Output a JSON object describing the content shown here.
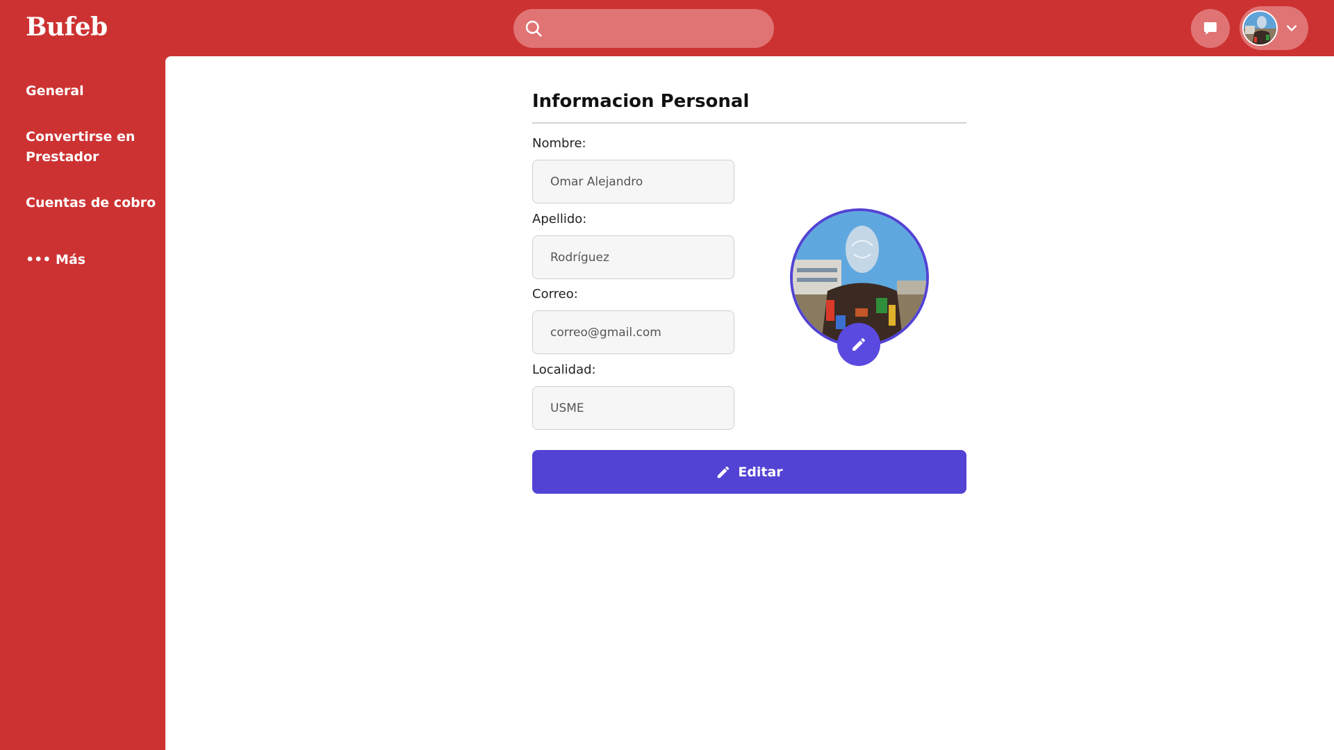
{
  "app": {
    "logo": "Bufeb"
  },
  "header": {
    "search_placeholder": "",
    "search_icon": "search-icon",
    "chat_icon": "chat-icon",
    "user_menu_icon": "chevron-down-icon"
  },
  "sidebar": {
    "items": [
      {
        "label": "General"
      },
      {
        "label": "Convertirse en Prestador"
      },
      {
        "label": "Cuentas de cobro"
      },
      {
        "label": "••• Más"
      }
    ]
  },
  "profile": {
    "title": "Informacion Personal",
    "fields": [
      {
        "label": "Nombre:",
        "value": "Omar Alejandro"
      },
      {
        "label": "Apellido:",
        "value": "Rodríguez"
      },
      {
        "label": "Correo:",
        "value": "correo@gmail.com"
      },
      {
        "label": "Localidad:",
        "value": "USME"
      }
    ],
    "photo_edit_icon": "pencil-icon",
    "edit_button": {
      "label": "Editar",
      "icon": "pencil-icon"
    }
  },
  "colors": {
    "brand_red": "#cd3232",
    "header_pill": "#e07474",
    "accent_purple": "#5243d4",
    "background": "#ffffff"
  }
}
